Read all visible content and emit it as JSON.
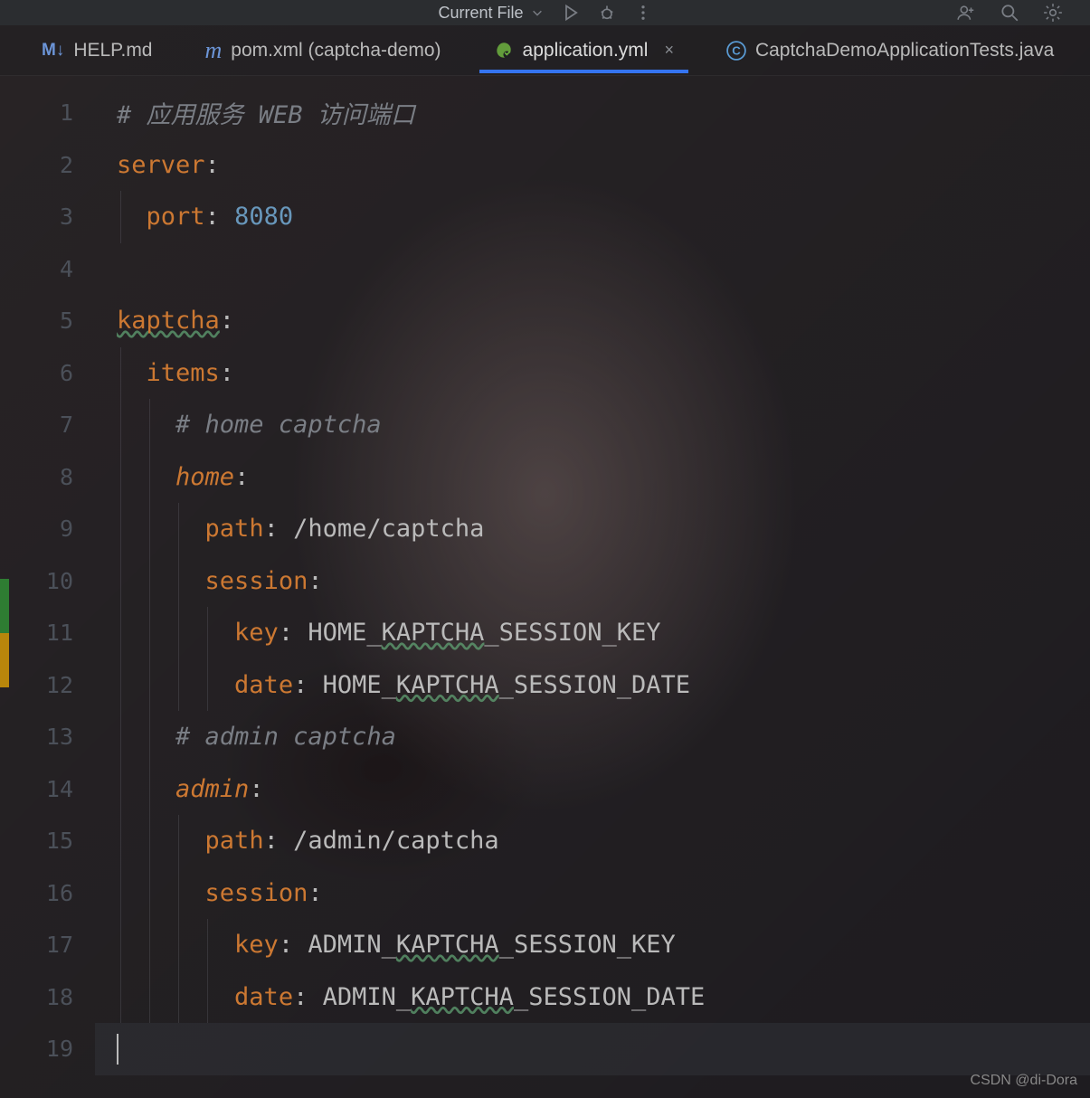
{
  "toolbar": {
    "run_config": "Current File",
    "icons": {
      "chevron": "chevron-down-icon",
      "run": "run-icon",
      "debug": "debug-icon",
      "more": "more-icon",
      "add_user": "add-user-icon",
      "search": "search-icon",
      "settings": "settings-icon"
    }
  },
  "tabs": [
    {
      "label": "HELP.md",
      "icon": "markdown-icon",
      "icon_text": "M↓",
      "active": false
    },
    {
      "label": "pom.xml (captcha-demo)",
      "icon": "maven-icon",
      "icon_text": "m",
      "active": false
    },
    {
      "label": "application.yml",
      "icon": "spring-icon",
      "icon_text": "⚙",
      "active": true
    },
    {
      "label": "CaptchaDemoApplicationTests.java",
      "icon": "java-class-icon",
      "icon_text": "Ⓒ",
      "active": false
    }
  ],
  "editor": {
    "lines": [
      {
        "n": 1,
        "indent": 0,
        "tokens": [
          [
            "comment",
            "# 应用服务 WEB 访问端口"
          ]
        ]
      },
      {
        "n": 2,
        "indent": 0,
        "tokens": [
          [
            "key",
            "server"
          ],
          [
            "colon",
            ":"
          ]
        ]
      },
      {
        "n": 3,
        "indent": 1,
        "tokens": [
          [
            "key",
            "port"
          ],
          [
            "colon",
            ": "
          ],
          [
            "num",
            "8080"
          ]
        ]
      },
      {
        "n": 4,
        "indent": 0,
        "tokens": []
      },
      {
        "n": 5,
        "indent": 0,
        "tokens": [
          [
            "key-u",
            "kaptcha"
          ],
          [
            "colon",
            ":"
          ]
        ]
      },
      {
        "n": 6,
        "indent": 1,
        "tokens": [
          [
            "key",
            "items"
          ],
          [
            "colon",
            ":"
          ]
        ]
      },
      {
        "n": 7,
        "indent": 2,
        "tokens": [
          [
            "comment",
            "# home captcha"
          ]
        ]
      },
      {
        "n": 8,
        "indent": 2,
        "tokens": [
          [
            "key-i",
            "home"
          ],
          [
            "colon",
            ":"
          ]
        ]
      },
      {
        "n": 9,
        "indent": 3,
        "tokens": [
          [
            "key",
            "path"
          ],
          [
            "colon",
            ": "
          ],
          [
            "val",
            "/home/captcha"
          ]
        ]
      },
      {
        "n": 10,
        "indent": 3,
        "tokens": [
          [
            "key",
            "session"
          ],
          [
            "colon",
            ":"
          ]
        ]
      },
      {
        "n": 11,
        "indent": 4,
        "tokens": [
          [
            "key",
            "key"
          ],
          [
            "colon",
            ": "
          ],
          [
            "val-u",
            "HOME_KAPTCHA_SESSION_KEY"
          ]
        ]
      },
      {
        "n": 12,
        "indent": 4,
        "tokens": [
          [
            "key",
            "date"
          ],
          [
            "colon",
            ": "
          ],
          [
            "val-u",
            "HOME_KAPTCHA_SESSION_DATE"
          ]
        ]
      },
      {
        "n": 13,
        "indent": 2,
        "tokens": [
          [
            "comment",
            "# admin captcha"
          ]
        ]
      },
      {
        "n": 14,
        "indent": 2,
        "tokens": [
          [
            "key-i",
            "admin"
          ],
          [
            "colon",
            ":"
          ]
        ]
      },
      {
        "n": 15,
        "indent": 3,
        "tokens": [
          [
            "key",
            "path"
          ],
          [
            "colon",
            ": "
          ],
          [
            "val",
            "/admin/captcha"
          ]
        ]
      },
      {
        "n": 16,
        "indent": 3,
        "tokens": [
          [
            "key",
            "session"
          ],
          [
            "colon",
            ":"
          ]
        ]
      },
      {
        "n": 17,
        "indent": 4,
        "tokens": [
          [
            "key",
            "key"
          ],
          [
            "colon",
            ": "
          ],
          [
            "val-u",
            "ADMIN_KAPTCHA_SESSION_KEY"
          ]
        ]
      },
      {
        "n": 18,
        "indent": 4,
        "tokens": [
          [
            "key",
            "date"
          ],
          [
            "colon",
            ": "
          ],
          [
            "val-u",
            "ADMIN_KAPTCHA_SESSION_DATE"
          ]
        ]
      },
      {
        "n": 19,
        "indent": 0,
        "tokens": [],
        "cursor": true,
        "hl": true
      }
    ],
    "indent_width": 2
  },
  "watermark": "CSDN @di-Dora"
}
